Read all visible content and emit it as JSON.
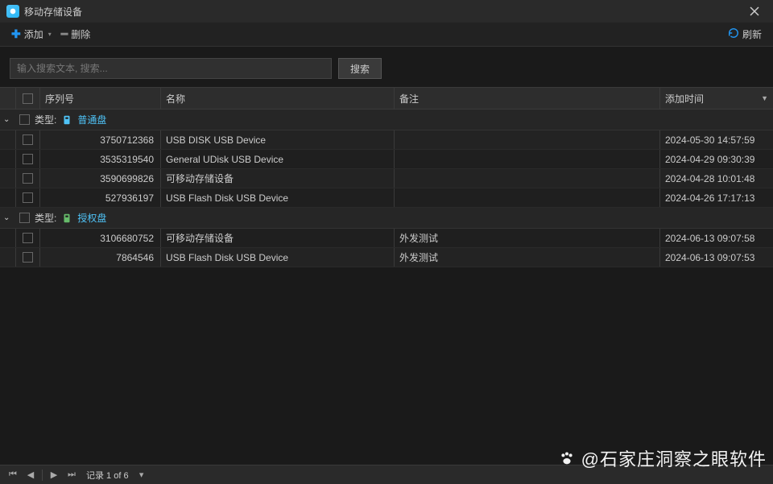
{
  "window": {
    "title": "移动存储设备"
  },
  "toolbar": {
    "add_label": "添加",
    "delete_label": "删除",
    "refresh_label": "刷新"
  },
  "search": {
    "placeholder": "输入搜索文本, 搜索...",
    "button": "搜索"
  },
  "columns": {
    "serial": "序列号",
    "name": "名称",
    "note": "备注",
    "time": "添加时间"
  },
  "groups": [
    {
      "label": "类型:",
      "value": "普通盘",
      "icon_color": "blue",
      "rows": [
        {
          "serial": "3750712368",
          "name": "USB DISK USB Device",
          "note": "",
          "time": "2024-05-30 14:57:59"
        },
        {
          "serial": "3535319540",
          "name": "General UDisk USB Device",
          "note": "",
          "time": "2024-04-29 09:30:39"
        },
        {
          "serial": "3590699826",
          "name": "可移动存储设备",
          "note": "",
          "time": "2024-04-28 10:01:48"
        },
        {
          "serial": "527936197",
          "name": "USB Flash Disk USB Device",
          "note": "",
          "time": "2024-04-26 17:17:13"
        }
      ]
    },
    {
      "label": "类型:",
      "value": "授权盘",
      "icon_color": "green",
      "rows": [
        {
          "serial": "3106680752",
          "name": "可移动存储设备",
          "note": "外发测试",
          "time": "2024-06-13 09:07:58"
        },
        {
          "serial": "7864546",
          "name": "USB Flash Disk USB Device",
          "note": "外发测试",
          "time": "2024-06-13 09:07:53"
        }
      ]
    }
  ],
  "footer": {
    "record_text": "记录 1 of 6"
  },
  "watermark": {
    "text": "@石家庄洞察之眼软件"
  }
}
